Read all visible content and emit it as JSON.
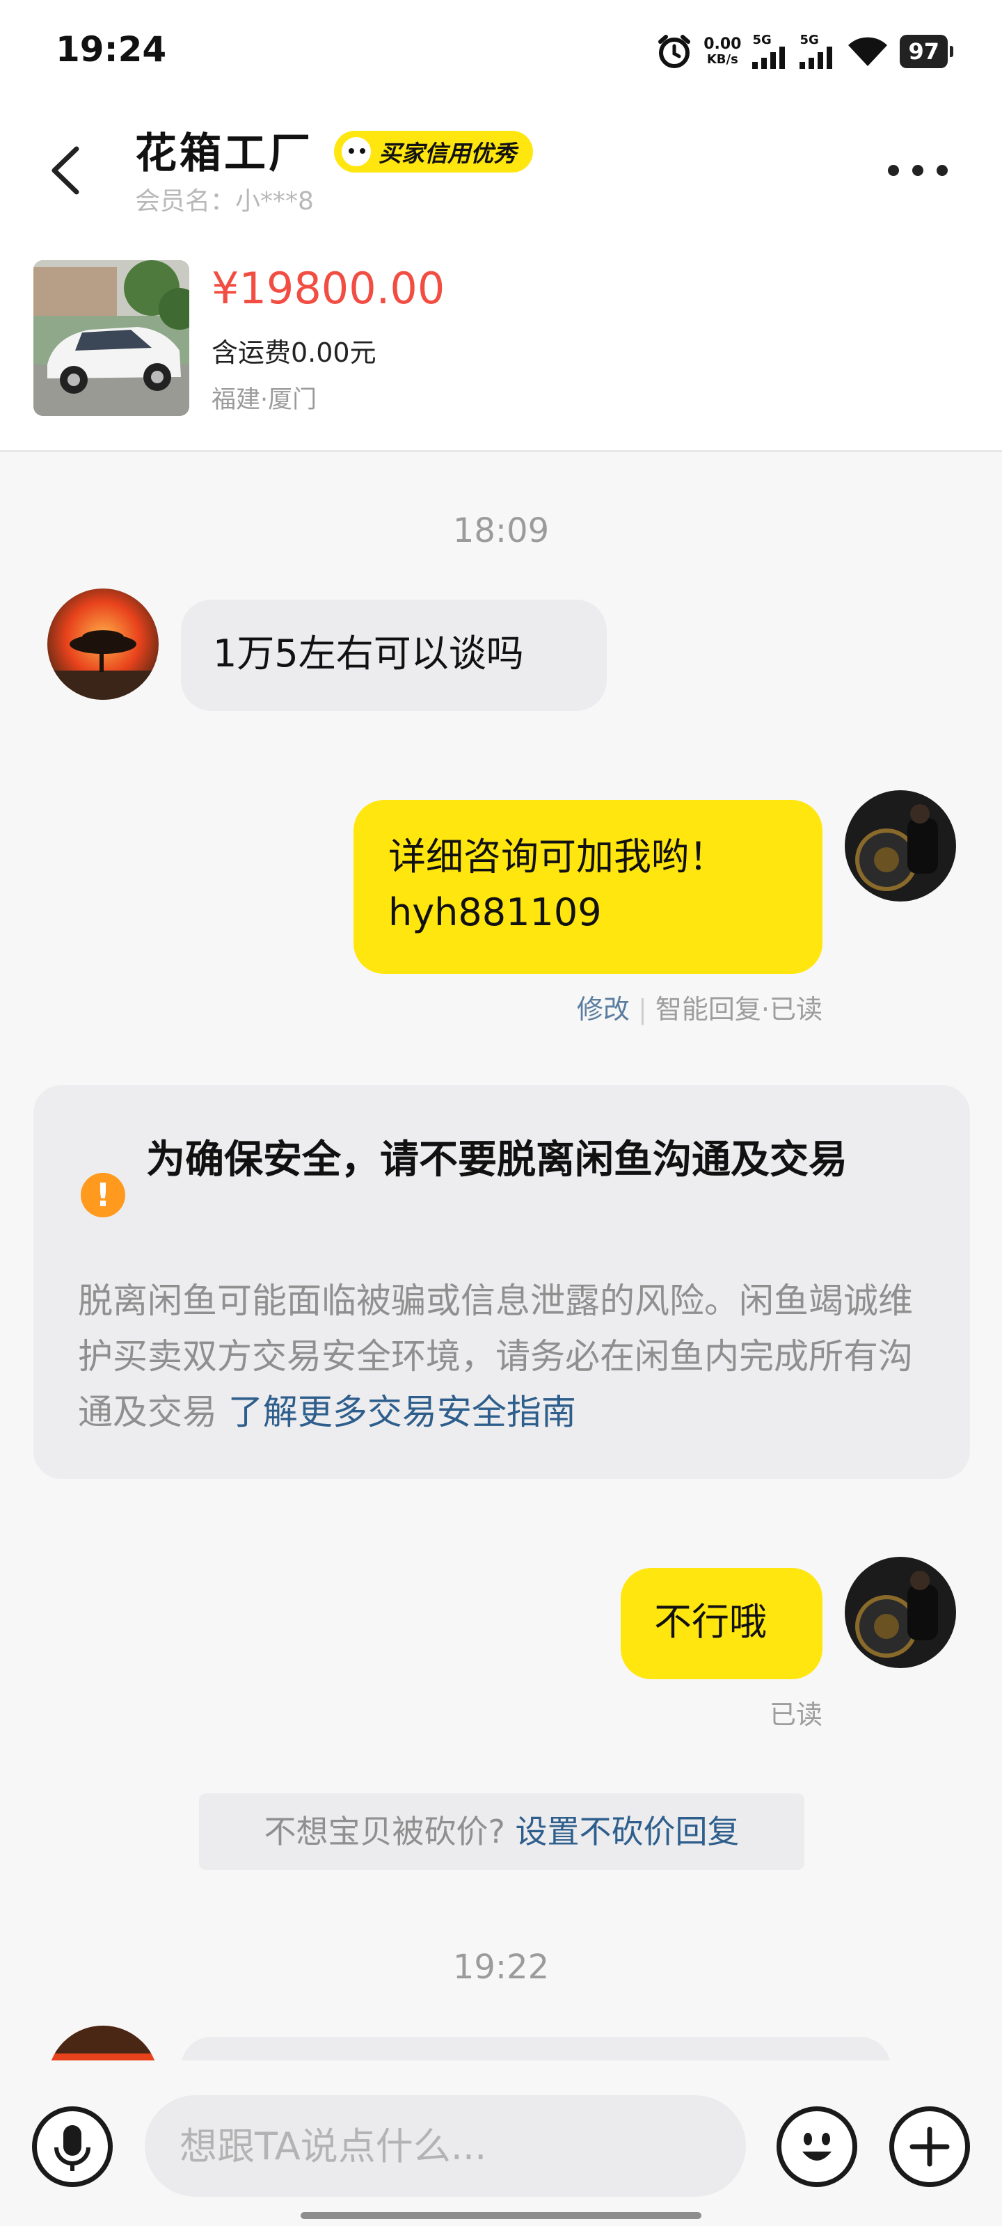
{
  "status_bar": {
    "time": "19:24",
    "net_speed_value": "0.00",
    "net_speed_unit": "KB/s",
    "signal1_label": "5G",
    "signal2_label": "5G",
    "battery": "97"
  },
  "header": {
    "shop_name": "花箱工厂",
    "credit_badge": "买家信用优秀",
    "member_name": "会员名：小***8"
  },
  "product": {
    "price": "¥19800.00",
    "shipping": "含运费0.00元",
    "location": "福建·厦门"
  },
  "chat": {
    "time1": "18:09",
    "msg1": "1万5左右可以谈吗",
    "msg2_line1": "详细咨询可加我哟！",
    "msg2_line2": "hyh881109",
    "msg2_edit": "修改",
    "msg2_sep": " | ",
    "msg2_status": "智能回复·已读",
    "warning_title": "为确保安全，请不要脱离闲鱼沟通及交易",
    "warning_body": "脱离闲鱼可能面临被骗或信息泄露的风险。闲鱼竭诚维护买卖双方交易安全环境，请务必在闲鱼内完成所有沟通及交易",
    "warning_link": "了解更多交易安全指南",
    "msg3": "不行哦",
    "msg3_status": "已读",
    "bargain_prompt": "不想宝贝被砍价?",
    "bargain_link": "设置不砍价回复",
    "time2": "19:22"
  },
  "input": {
    "placeholder": "想跟TA说点什么..."
  },
  "icons": {
    "back": "chevron-left-icon",
    "more": "more-dots-icon",
    "voice": "microphone-icon",
    "emoji": "emoji-icon",
    "plus": "plus-icon",
    "warning": "exclamation-icon"
  },
  "colors": {
    "accent_yellow": "#ffe60f",
    "price_red": "#f24d42",
    "link_blue": "#2e5e8c",
    "warning_orange": "#ff9a1f"
  }
}
